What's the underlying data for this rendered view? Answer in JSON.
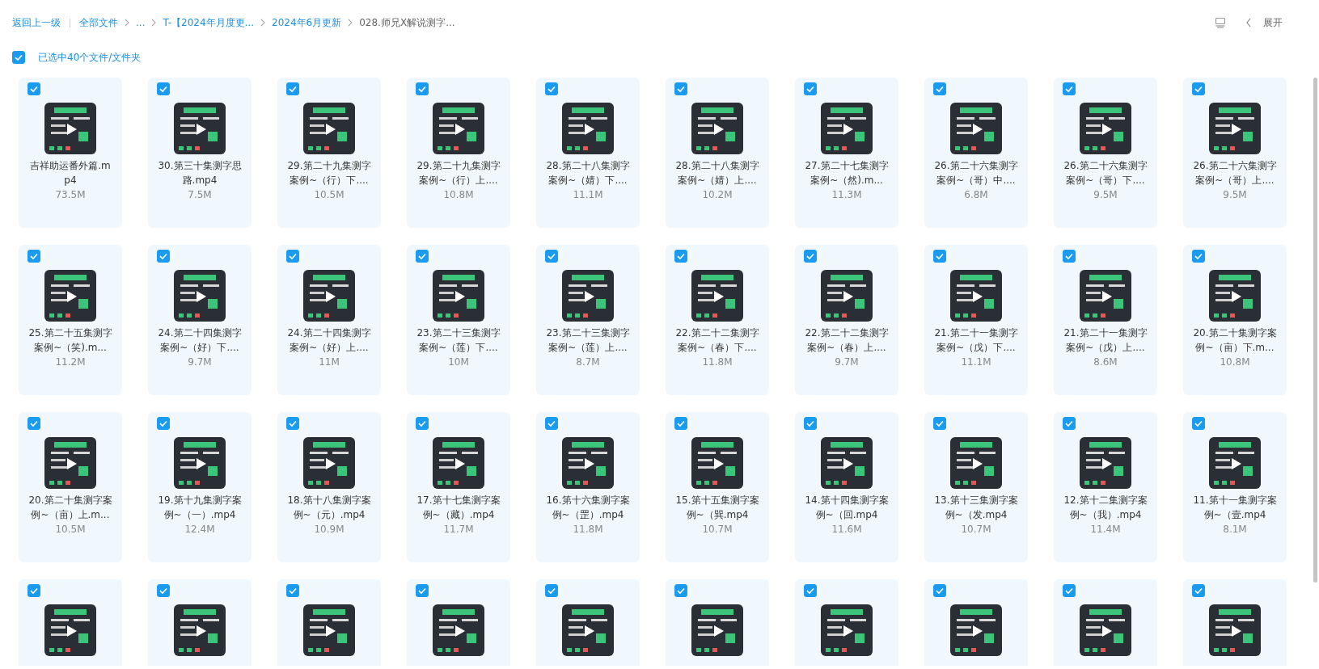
{
  "breadcrumb": {
    "back": "返回上一级",
    "crumbs": [
      {
        "label": "全部文件",
        "current": false
      },
      {
        "label": "...",
        "current": false
      },
      {
        "label": "T-【2024年月度更...",
        "current": false
      },
      {
        "label": "2024年6月更新",
        "current": false
      },
      {
        "label": "028.师兄X解说测字...",
        "current": true
      }
    ]
  },
  "toolbar": {
    "expand": "展开"
  },
  "select_all": {
    "checked": true,
    "label": "已选中40个文件/文件夹"
  },
  "files": [
    {
      "name": "吉祥助运番外篇.mp4",
      "size": "73.5M",
      "selected": true
    },
    {
      "name": "30.第三十集测字思路.mp4",
      "size": "7.5M",
      "selected": true
    },
    {
      "name": "29.第二十九集测字案例~（行）下....",
      "size": "10.5M",
      "selected": true
    },
    {
      "name": "29.第二十九集测字案例~（行）上....",
      "size": "10.8M",
      "selected": true
    },
    {
      "name": "28.第二十八集测字案例~（婧）下....",
      "size": "11.1M",
      "selected": true
    },
    {
      "name": "28.第二十八集测字案例~（婧）上....",
      "size": "10.2M",
      "selected": true
    },
    {
      "name": "27.第二十七集测字案例~（然).m...",
      "size": "11.3M",
      "selected": true
    },
    {
      "name": "26.第二十六集测字案例~（哥）中....",
      "size": "6.8M",
      "selected": true
    },
    {
      "name": "26.第二十六集测字案例~（哥）下....",
      "size": "9.5M",
      "selected": true
    },
    {
      "name": "26.第二十六集测字案例~（哥）上....",
      "size": "9.5M",
      "selected": true
    },
    {
      "name": "25.第二十五集测字案例~（笑).m...",
      "size": "11.2M",
      "selected": true
    },
    {
      "name": "24.第二十四集测字案例~（好）下....",
      "size": "9.7M",
      "selected": true
    },
    {
      "name": "24.第二十四集测字案例~（好）上....",
      "size": "11M",
      "selected": true
    },
    {
      "name": "23.第二十三集测字案例~（莲）下....",
      "size": "10M",
      "selected": true
    },
    {
      "name": "23.第二十三集测字案例~（莲）上....",
      "size": "8.7M",
      "selected": true
    },
    {
      "name": "22.第二十二集测字案例~（春）下....",
      "size": "11.8M",
      "selected": true
    },
    {
      "name": "22.第二十二集测字案例~（春）上....",
      "size": "9.7M",
      "selected": true
    },
    {
      "name": "21.第二十一集测字案例~（戊）下....",
      "size": "11.1M",
      "selected": true
    },
    {
      "name": "21.第二十一集测字案例~（戊）上....",
      "size": "8.6M",
      "selected": true
    },
    {
      "name": "20.第二十集测字案例~（亩）下.m...",
      "size": "10.8M",
      "selected": true
    },
    {
      "name": "20.第二十集测字案例~（亩）上.m...",
      "size": "10.5M",
      "selected": true
    },
    {
      "name": "19.第十九集测字案例~（一）.mp4",
      "size": "12.4M",
      "selected": true
    },
    {
      "name": "18.第十八集测字案例~（元）.mp4",
      "size": "10.9M",
      "selected": true
    },
    {
      "name": "17.第十七集测字案例~（藏）.mp4",
      "size": "11.7M",
      "selected": true
    },
    {
      "name": "16.第十六集测字案例~（罡）.mp4",
      "size": "11.8M",
      "selected": true
    },
    {
      "name": "15.第十五集测字案例~（巽.mp4",
      "size": "10.7M",
      "selected": true
    },
    {
      "name": "14.第十四集测字案例~（回.mp4",
      "size": "11.6M",
      "selected": true
    },
    {
      "name": "13.第十三集测字案例~（发.mp4",
      "size": "10.7M",
      "selected": true
    },
    {
      "name": "12.第十二集测字案例~（我）.mp4",
      "size": "11.4M",
      "selected": true
    },
    {
      "name": "11.第十一集测字案例~（壹.mp4",
      "size": "8.1M",
      "selected": true
    },
    {
      "selected": true
    },
    {
      "selected": true
    },
    {
      "selected": true
    },
    {
      "selected": true
    },
    {
      "selected": true
    },
    {
      "selected": true
    },
    {
      "selected": true
    },
    {
      "selected": true
    },
    {
      "selected": true
    },
    {
      "selected": true
    }
  ]
}
